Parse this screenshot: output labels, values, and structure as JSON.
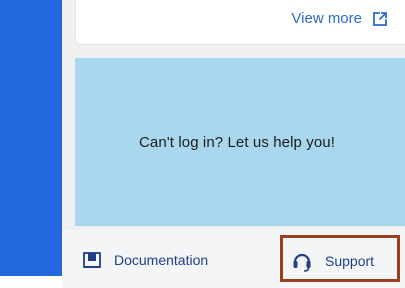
{
  "top_card": {
    "view_more_label": "View more",
    "external_icon": "external-link-icon"
  },
  "help_panel": {
    "text": "Can't log in? Let us help you!"
  },
  "footer": {
    "documentation_label": "Documentation",
    "documentation_icon": "book-icon",
    "support_label": "Support",
    "support_icon": "headset-icon"
  },
  "colors": {
    "accent_blue": "#2469e0",
    "link_blue": "#2c6bcc",
    "help_panel_bg": "#a9d8ee",
    "footer_text": "#1f3f86",
    "highlight_border": "#9b3f1e"
  }
}
